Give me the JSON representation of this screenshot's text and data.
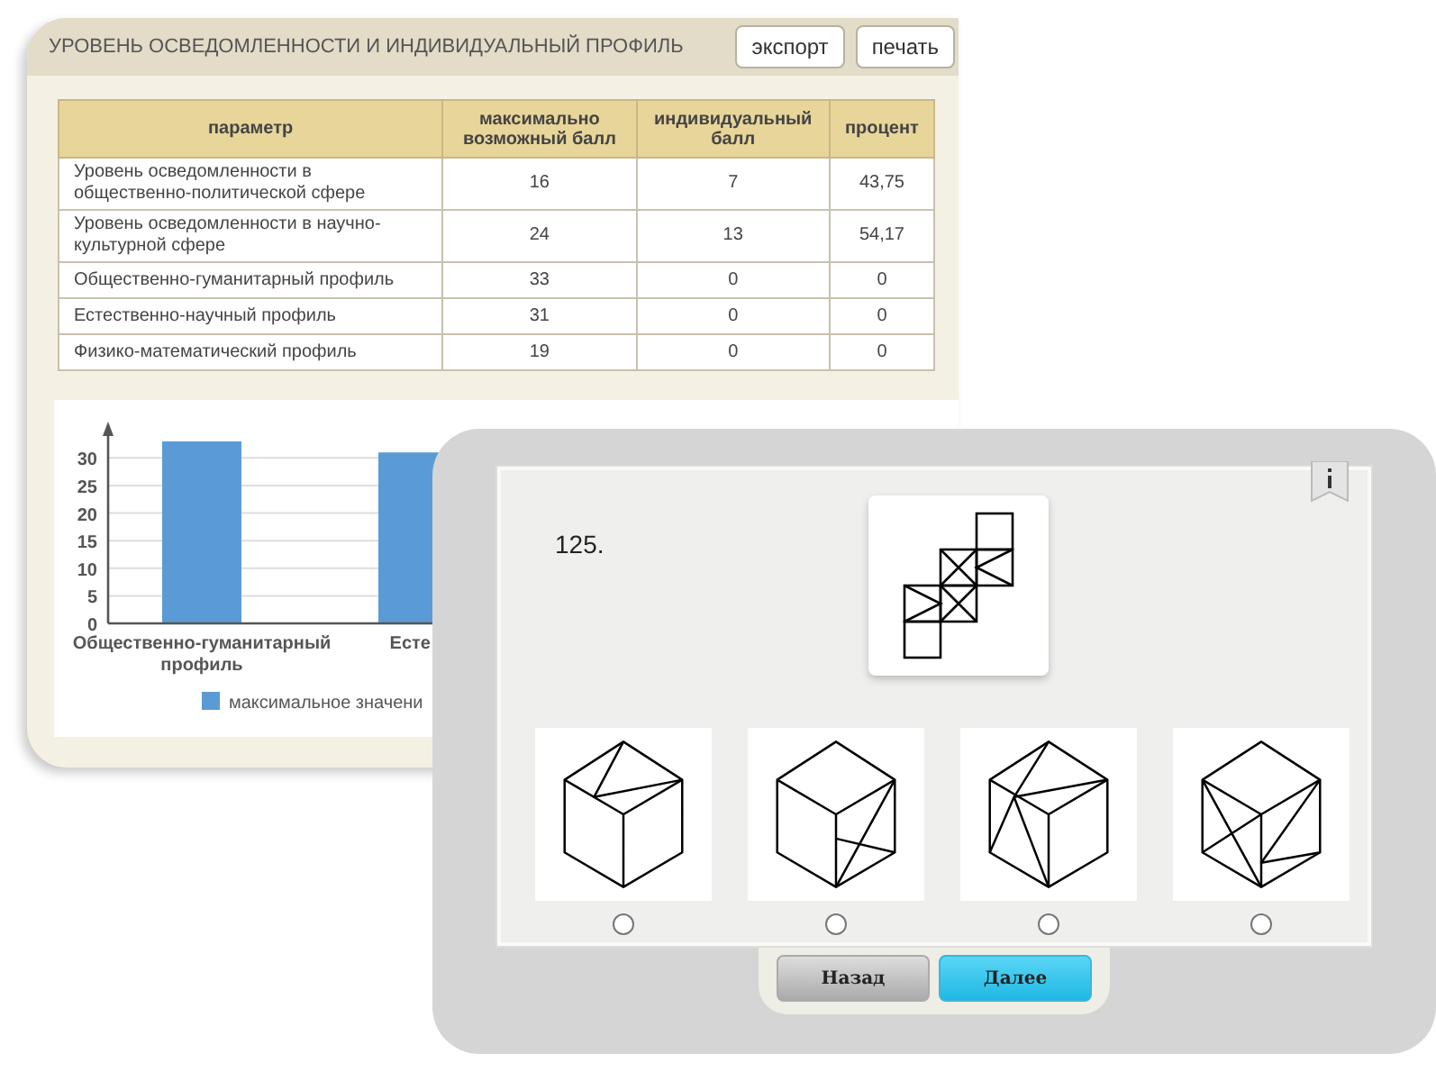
{
  "report": {
    "title": "УРОВЕНЬ ОСВЕДОМЛЕННОСТИ И ИНДИВИДУАЛЬНЫЙ ПРОФИЛЬ",
    "buttons": [
      "экспорт",
      "печать"
    ],
    "table": {
      "columns": [
        "параметр",
        "максимально возможный балл",
        "индивидуальный балл",
        "процент"
      ],
      "rows": [
        [
          "Уровень осведомленности в общественно-политической сфере",
          "16",
          "7",
          "43,75"
        ],
        [
          "Уровень осведомленности в научно-культурной сфере",
          "24",
          "13",
          "54,17"
        ],
        [
          "Общественно-гуманитарный профиль",
          "33",
          "0",
          "0"
        ],
        [
          "Естественно-научный профиль",
          "31",
          "0",
          "0"
        ],
        [
          "Физико-математический профиль",
          "19",
          "0",
          "0"
        ]
      ]
    },
    "chart": {
      "chart_data": {
        "type": "bar",
        "categories": [
          "Общественно-гуманитарный профиль",
          "Есте"
        ],
        "yticks": [
          0,
          5,
          10,
          15,
          20,
          25,
          30
        ],
        "ylim": [
          0,
          33
        ],
        "grid": true,
        "series": [
          {
            "name": "максимальное значени",
            "color": "#5b9bd5",
            "values": [
              33,
              31
            ]
          }
        ]
      }
    }
  },
  "question": {
    "number": "125.",
    "options": [
      {
        "selected": false
      },
      {
        "selected": false
      },
      {
        "selected": false
      },
      {
        "selected": false
      }
    ],
    "buttons": [
      {
        "label": "Назад",
        "kind": "back"
      },
      {
        "label": "Далее",
        "kind": "next"
      }
    ]
  }
}
